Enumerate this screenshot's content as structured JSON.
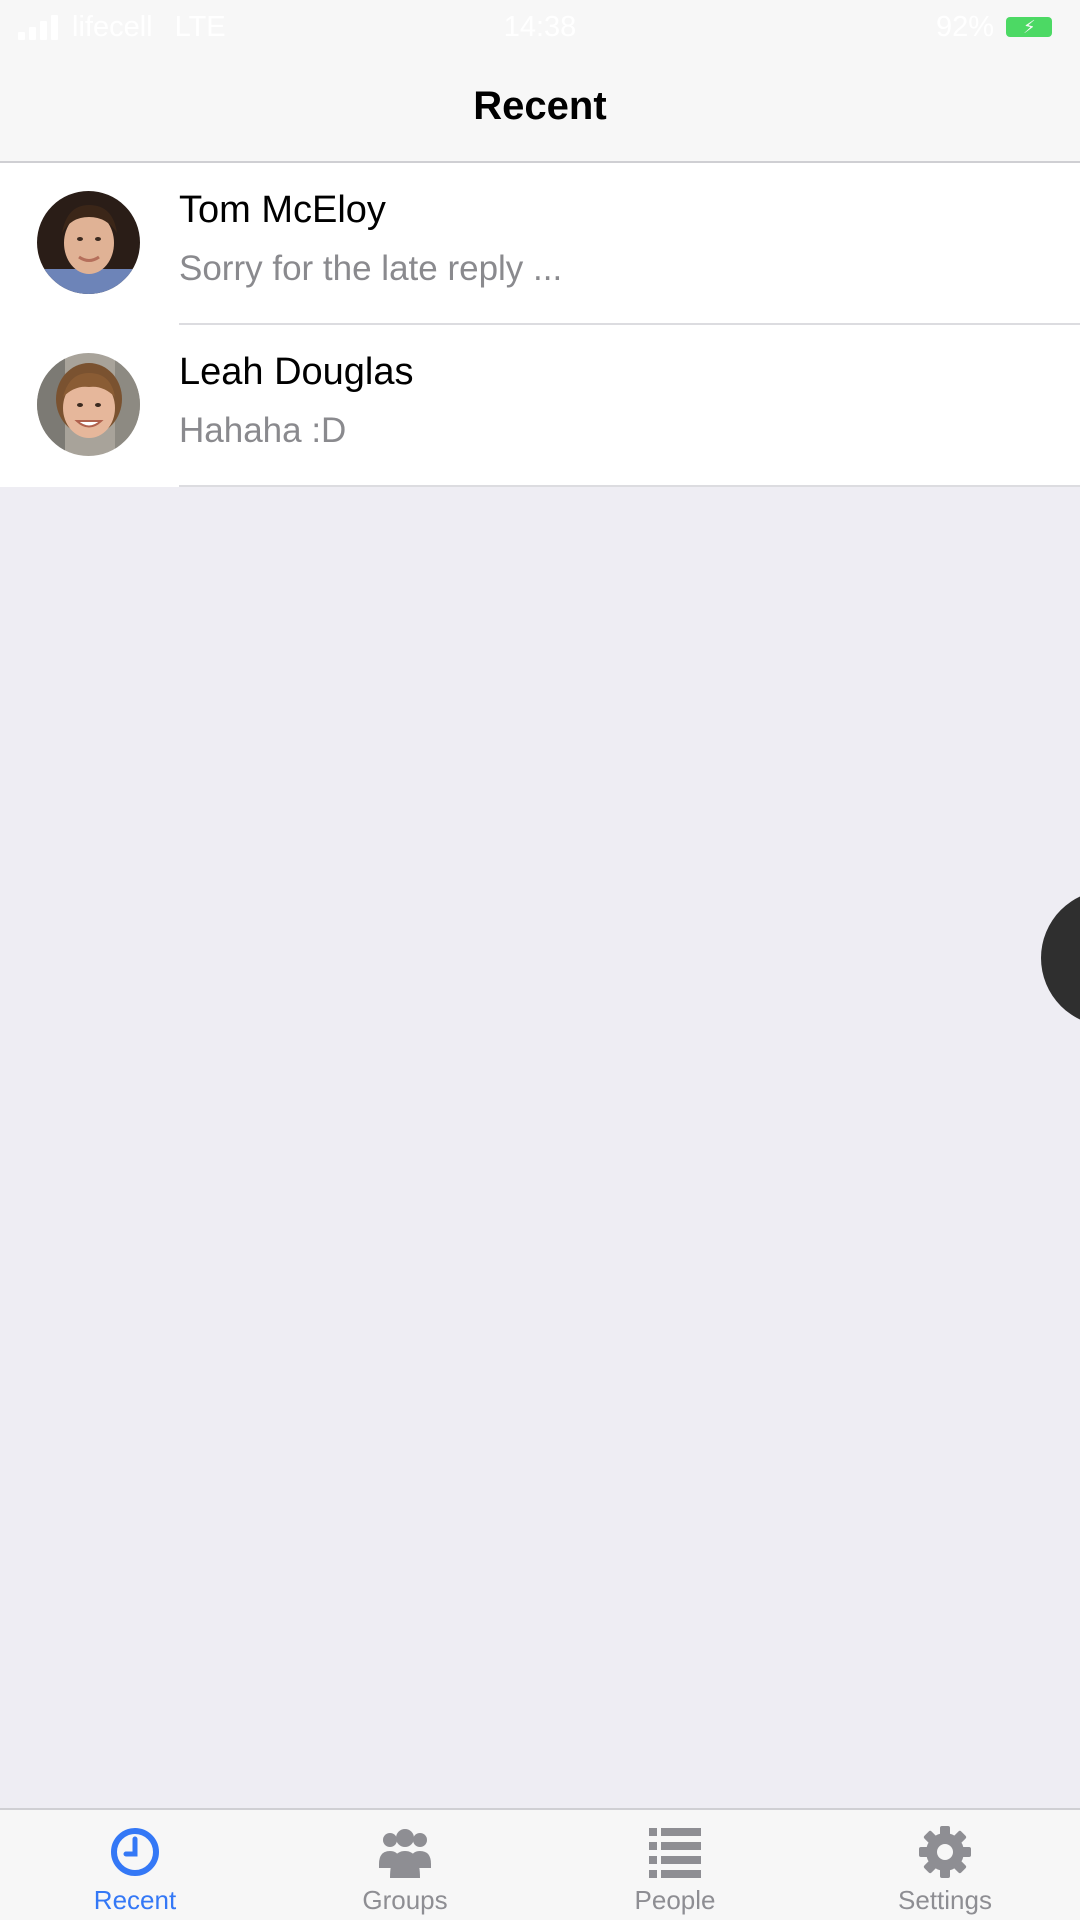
{
  "status_bar": {
    "carrier": "lifecell",
    "network": "LTE",
    "time": "14:38",
    "battery": "92%"
  },
  "nav": {
    "title": "Recent"
  },
  "chats": [
    {
      "name": "Tom McEloy",
      "preview": "Sorry for the late reply ..."
    },
    {
      "name": "Leah Douglas",
      "preview": "Hahaha :D"
    }
  ],
  "tabs": [
    {
      "label": "Recent",
      "icon": "clock-icon",
      "active": true
    },
    {
      "label": "Groups",
      "icon": "group-icon",
      "active": false
    },
    {
      "label": "People",
      "icon": "list-icon",
      "active": false
    },
    {
      "label": "Settings",
      "icon": "gear-icon",
      "active": false
    }
  ],
  "colors": {
    "accent": "#3478f6",
    "inactive": "#8e8e93",
    "battery": "#4cd964",
    "background": "#eeedf3"
  }
}
